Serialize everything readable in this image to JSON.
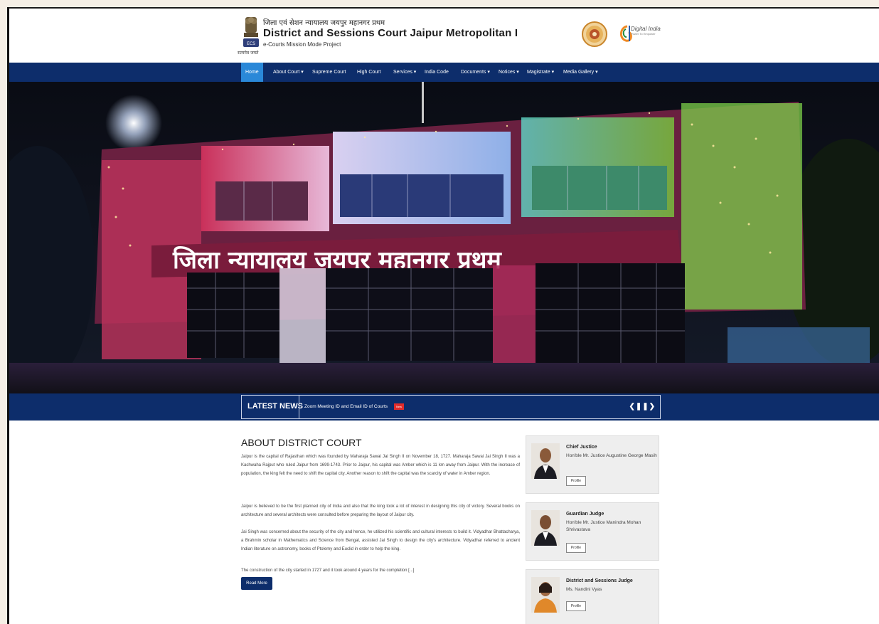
{
  "header": {
    "hindi_title": "जिला एवं सेशन न्यायालय जयपुर महानगर प्रथम",
    "title": "District and Sessions Court Jaipur Metropolitan I",
    "subtitle": "e-Courts Mission Mode Project",
    "emblem_caption": "सत्यमेव जयते",
    "digital_india": "Digital India",
    "digital_india_tagline": "Power To Empower"
  },
  "nav": {
    "items": [
      {
        "label": "Home",
        "active": true
      },
      {
        "label": "About Court ▾"
      },
      {
        "label": "Supreme Court"
      },
      {
        "label": "High Court"
      },
      {
        "label": "Services ▾"
      },
      {
        "label": "India Code"
      },
      {
        "label": "Documents ▾"
      },
      {
        "label": "Notices ▾"
      },
      {
        "label": "Magistrate ▾"
      },
      {
        "label": "Media Gallery ▾"
      }
    ]
  },
  "hero": {
    "building_sign": "जिला न्यायालय जयपुर महानगर प्रथम"
  },
  "news": {
    "label": "LATEST NEWS",
    "item": "Zoom Meeting ID and Email ID of Courts",
    "badge": "New",
    "controls": "❮❚❚❯"
  },
  "about": {
    "title": "ABOUT DISTRICT COURT",
    "p1": "Jaipur is the capital of Rajasthan which was founded by Maharaja Sawai Jai Singh II on November 18, 1727. Maharaja Sawai Jai Singh II was a Kachwaha Rajput who ruled Jaipur from 1699-1743. Prior to Jaipur, his capital was Amber which is 11 km away from Jaipur. With the increase of population, the king felt the need to shift the capital city. Another reason to shift the capital was the scarcity of water in Amber region.",
    "p2": "Jaipur is believed to be the first planned city of India and also that the king took a lot of interest in designing this city of victory. Several books on architecture and several architects were consulted before preparing the layout of Jaipur city.",
    "p3": "Jai Singh was concerned about the security of the city and hence, he utilized his scientific and cultural interests to build it. Vidyadhar Bhattacharya, a Brahmin scholar in Mathematics and Science from Bengal, assisted Jai Singh to design the city's architecture. Vidyadhar referred to ancient Indian literature on astronomy, books of Ptolemy and Euclid in order to help the king.",
    "p4": "The construction of the city started in 1727 and it took around 4 years for the completion [...]",
    "read_more": "Read More"
  },
  "judges": [
    {
      "role": "Chief Justice",
      "name": "Hon'ble Mr. Justice Augustine George Masih",
      "profile": "Profile"
    },
    {
      "role": "Guardian Judge",
      "name": "Hon'ble Mr. Justice Manindra Mohan Shrivastava",
      "profile": "Profile"
    },
    {
      "role": "District and Sessions Judge",
      "name": "Ms. Nandini Vyas",
      "profile": "Profile"
    }
  ]
}
